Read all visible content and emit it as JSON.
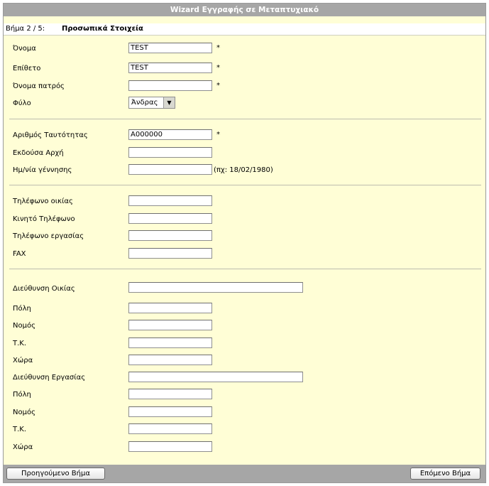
{
  "window_title": "Wizard Εγγραφής σε Μεταπτυχιακό",
  "step": {
    "number": "Βήμα 2 / 5:",
    "title": "Προσωπικά Στοιχεία"
  },
  "required_mark": "*",
  "personal": {
    "first_name": {
      "label": "Όνομα",
      "value": "TEST"
    },
    "last_name": {
      "label": "Επίθετο",
      "value": "TEST"
    },
    "father_name": {
      "label": "Όνομα πατρός",
      "value": ""
    },
    "gender": {
      "label": "Φύλο",
      "value": "Άνδρας"
    }
  },
  "identity": {
    "id_number": {
      "label": "Αριθμός Ταυτότητας",
      "value": "Α000000"
    },
    "issuing_authority": {
      "label": "Εκδούσα Αρχή",
      "value": ""
    },
    "birth_date": {
      "label": "Ημ/νία γέννησης",
      "value": "",
      "hint": "(πχ: 18/02/1980)"
    }
  },
  "phones": {
    "home_phone": {
      "label": "Τηλέφωνο οικίας",
      "value": ""
    },
    "mobile_phone": {
      "label": "Κινητό Τηλέφωνο",
      "value": ""
    },
    "work_phone": {
      "label": "Τηλέφωνο εργασίας",
      "value": ""
    },
    "fax": {
      "label": "FAX",
      "value": ""
    }
  },
  "home_address": {
    "address": {
      "label": "Διεύθυνση Οικίας",
      "value": ""
    },
    "city": {
      "label": "Πόλη",
      "value": ""
    },
    "prefecture": {
      "label": "Νομός",
      "value": ""
    },
    "postal_code": {
      "label": "Τ.Κ.",
      "value": ""
    },
    "country": {
      "label": "Χώρα",
      "value": ""
    }
  },
  "work_address": {
    "address": {
      "label": "Διεύθυνση Εργασίας",
      "value": ""
    },
    "city": {
      "label": "Πόλη",
      "value": ""
    },
    "prefecture": {
      "label": "Νομός",
      "value": ""
    },
    "postal_code": {
      "label": "Τ.Κ.",
      "value": ""
    },
    "country": {
      "label": "Χώρα",
      "value": ""
    }
  },
  "buttons": {
    "previous": "Προηγούμενο Βήμα",
    "next": "Επόμενο Βήμα"
  },
  "colors": {
    "form_background": "#fffed6",
    "bars": "#a6a6a6"
  }
}
